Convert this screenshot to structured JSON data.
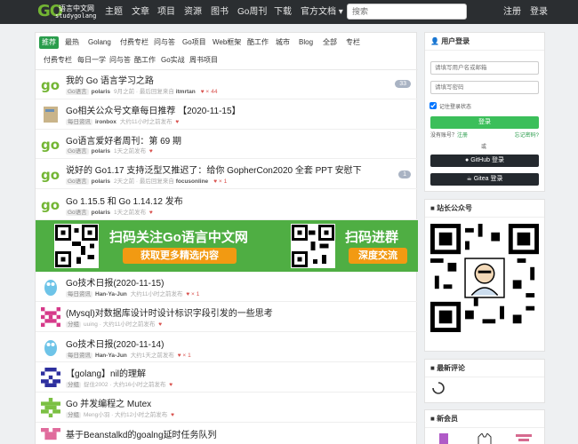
{
  "site": {
    "logo_mark": "GO",
    "logo_cn": "语言中文网",
    "logo_en": "studygolang"
  },
  "nav": {
    "items": [
      "主题",
      "文章",
      "项目",
      "资源",
      "图书",
      "Go周刊",
      "下载",
      "官方文档 ▾"
    ],
    "search_placeholder": "搜索",
    "register": "注册",
    "login": "登录"
  },
  "tabs_row1": [
    "推荐",
    "最热",
    "Golang",
    "付费专栏",
    "问与答",
    "Go项目",
    "Web框架",
    "酷工作",
    "城市",
    "Blog",
    "全部",
    "专栏"
  ],
  "tabs_row2": [
    "付费专栏",
    "每日一学",
    "问与答",
    "酷工作",
    "Go实战",
    "周书项目"
  ],
  "topics": [
    {
      "title": "我的 Go 语言学习之路",
      "node": "Go语言",
      "user": "polaris",
      "time": "9月之前 · 最后回复来自",
      "last": "itmrtan",
      "likes": "44",
      "count": "33"
    },
    {
      "title": "Go相关公众号文章每日推荐 【2020-11-15】",
      "node": "每日资讯",
      "user": "ironbox",
      "time": "大约11小时之前发布",
      "last": "",
      "likes": "",
      "count": ""
    },
    {
      "title": "Go语言爱好者周刊：第 69 期",
      "node": "Go语言",
      "user": "polaris",
      "time": "1天之前发布",
      "last": "",
      "likes": "",
      "count": ""
    },
    {
      "title": "说好的 Go1.17 支持泛型又推迟了：给你 GopherCon2020 全套 PPT 安慰下",
      "node": "Go语言",
      "user": "polaris",
      "time": "2天之前 · 最后回复来自",
      "last": "focusonline",
      "likes": "1",
      "count": "1"
    },
    {
      "title": "Go 1.15.5 和 Go 1.14.12 发布",
      "node": "Go语言",
      "user": "polaris",
      "time": "1天之前发布",
      "last": "",
      "likes": "",
      "count": ""
    },
    {
      "title": "Go技术日报(2020-11-15)",
      "node": "每日资讯",
      "user": "Han-Ya-Jun",
      "time": "大约11小时之前发布",
      "last": "",
      "likes": "1",
      "count": ""
    },
    {
      "title": "(Mysql)对数据库设计时设计标识字段引发的一些思考",
      "node": "分组",
      "user": "uuing",
      "time": "大约11小时之前发布",
      "last": "",
      "likes": "",
      "count": ""
    },
    {
      "title": "Go技术日报(2020-11-14)",
      "node": "每日资讯",
      "user": "Han-Ya-Jun",
      "time": "大约1天之前发布",
      "last": "",
      "likes": "1",
      "count": ""
    },
    {
      "title": "【golang】nil的理解",
      "node": "分组",
      "user": "捉住2002",
      "time": "大约16小时之前发布",
      "last": "",
      "likes": "",
      "count": ""
    },
    {
      "title": "Go 并发编程之 Mutex",
      "node": "分组",
      "user": "Meng小羽",
      "time": "大约12小时之前发布",
      "last": "",
      "likes": "",
      "count": ""
    },
    {
      "title": "基于Beanstalkd的goalng延时任务队列",
      "node": "",
      "user": "",
      "time": "",
      "last": "",
      "likes": "",
      "count": ""
    }
  ],
  "banner": {
    "left_big": "扫码关注Go语言中文网",
    "left_pill": "获取更多精选内容",
    "right_big": "扫码进群",
    "right_pill": "深度交流"
  },
  "login": {
    "title": "用户登录",
    "user_placeholder": "请填写用户名或邮箱",
    "pass_placeholder": "请填写密码",
    "remember": "记住登录状态",
    "submit": "登录",
    "no_account": "没有账号？",
    "register": "注册",
    "forgot": "忘记密码?",
    "or": "或",
    "github": "GitHub 登录",
    "gitea": "Gitea 登录"
  },
  "wechat": {
    "title": "站长公众号"
  },
  "comments": {
    "title": "最新评论"
  },
  "members": {
    "title": "新会员"
  },
  "colors": {
    "brand": "#2a9d4c",
    "nav_bg": "#2b2e31",
    "banner_bg": "#4fae43",
    "accent": "#f29a12"
  }
}
